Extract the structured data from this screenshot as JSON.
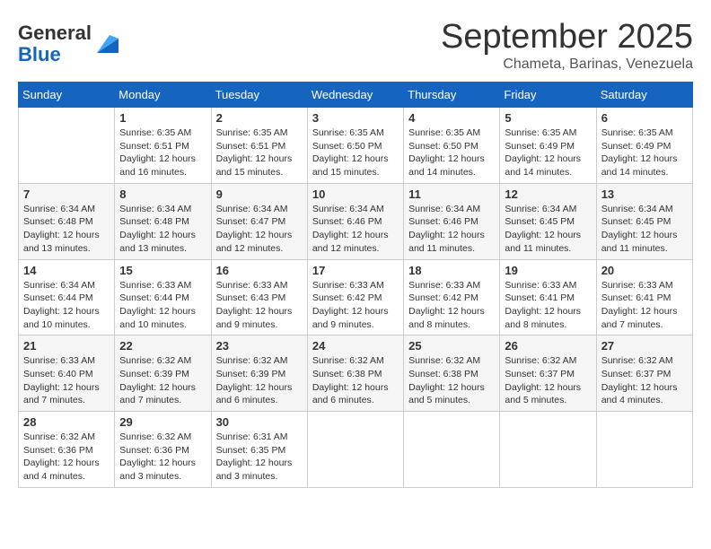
{
  "header": {
    "logo_line1": "General",
    "logo_line2": "Blue",
    "month": "September 2025",
    "location": "Chameta, Barinas, Venezuela"
  },
  "days_of_week": [
    "Sunday",
    "Monday",
    "Tuesday",
    "Wednesday",
    "Thursday",
    "Friday",
    "Saturday"
  ],
  "weeks": [
    [
      {
        "day": "",
        "info": ""
      },
      {
        "day": "1",
        "info": "Sunrise: 6:35 AM\nSunset: 6:51 PM\nDaylight: 12 hours\nand 16 minutes."
      },
      {
        "day": "2",
        "info": "Sunrise: 6:35 AM\nSunset: 6:51 PM\nDaylight: 12 hours\nand 15 minutes."
      },
      {
        "day": "3",
        "info": "Sunrise: 6:35 AM\nSunset: 6:50 PM\nDaylight: 12 hours\nand 15 minutes."
      },
      {
        "day": "4",
        "info": "Sunrise: 6:35 AM\nSunset: 6:50 PM\nDaylight: 12 hours\nand 14 minutes."
      },
      {
        "day": "5",
        "info": "Sunrise: 6:35 AM\nSunset: 6:49 PM\nDaylight: 12 hours\nand 14 minutes."
      },
      {
        "day": "6",
        "info": "Sunrise: 6:35 AM\nSunset: 6:49 PM\nDaylight: 12 hours\nand 14 minutes."
      }
    ],
    [
      {
        "day": "7",
        "info": "Sunrise: 6:34 AM\nSunset: 6:48 PM\nDaylight: 12 hours\nand 13 minutes."
      },
      {
        "day": "8",
        "info": "Sunrise: 6:34 AM\nSunset: 6:48 PM\nDaylight: 12 hours\nand 13 minutes."
      },
      {
        "day": "9",
        "info": "Sunrise: 6:34 AM\nSunset: 6:47 PM\nDaylight: 12 hours\nand 12 minutes."
      },
      {
        "day": "10",
        "info": "Sunrise: 6:34 AM\nSunset: 6:46 PM\nDaylight: 12 hours\nand 12 minutes."
      },
      {
        "day": "11",
        "info": "Sunrise: 6:34 AM\nSunset: 6:46 PM\nDaylight: 12 hours\nand 11 minutes."
      },
      {
        "day": "12",
        "info": "Sunrise: 6:34 AM\nSunset: 6:45 PM\nDaylight: 12 hours\nand 11 minutes."
      },
      {
        "day": "13",
        "info": "Sunrise: 6:34 AM\nSunset: 6:45 PM\nDaylight: 12 hours\nand 11 minutes."
      }
    ],
    [
      {
        "day": "14",
        "info": "Sunrise: 6:34 AM\nSunset: 6:44 PM\nDaylight: 12 hours\nand 10 minutes."
      },
      {
        "day": "15",
        "info": "Sunrise: 6:33 AM\nSunset: 6:44 PM\nDaylight: 12 hours\nand 10 minutes."
      },
      {
        "day": "16",
        "info": "Sunrise: 6:33 AM\nSunset: 6:43 PM\nDaylight: 12 hours\nand 9 minutes."
      },
      {
        "day": "17",
        "info": "Sunrise: 6:33 AM\nSunset: 6:42 PM\nDaylight: 12 hours\nand 9 minutes."
      },
      {
        "day": "18",
        "info": "Sunrise: 6:33 AM\nSunset: 6:42 PM\nDaylight: 12 hours\nand 8 minutes."
      },
      {
        "day": "19",
        "info": "Sunrise: 6:33 AM\nSunset: 6:41 PM\nDaylight: 12 hours\nand 8 minutes."
      },
      {
        "day": "20",
        "info": "Sunrise: 6:33 AM\nSunset: 6:41 PM\nDaylight: 12 hours\nand 7 minutes."
      }
    ],
    [
      {
        "day": "21",
        "info": "Sunrise: 6:33 AM\nSunset: 6:40 PM\nDaylight: 12 hours\nand 7 minutes."
      },
      {
        "day": "22",
        "info": "Sunrise: 6:32 AM\nSunset: 6:39 PM\nDaylight: 12 hours\nand 7 minutes."
      },
      {
        "day": "23",
        "info": "Sunrise: 6:32 AM\nSunset: 6:39 PM\nDaylight: 12 hours\nand 6 minutes."
      },
      {
        "day": "24",
        "info": "Sunrise: 6:32 AM\nSunset: 6:38 PM\nDaylight: 12 hours\nand 6 minutes."
      },
      {
        "day": "25",
        "info": "Sunrise: 6:32 AM\nSunset: 6:38 PM\nDaylight: 12 hours\nand 5 minutes."
      },
      {
        "day": "26",
        "info": "Sunrise: 6:32 AM\nSunset: 6:37 PM\nDaylight: 12 hours\nand 5 minutes."
      },
      {
        "day": "27",
        "info": "Sunrise: 6:32 AM\nSunset: 6:37 PM\nDaylight: 12 hours\nand 4 minutes."
      }
    ],
    [
      {
        "day": "28",
        "info": "Sunrise: 6:32 AM\nSunset: 6:36 PM\nDaylight: 12 hours\nand 4 minutes."
      },
      {
        "day": "29",
        "info": "Sunrise: 6:32 AM\nSunset: 6:36 PM\nDaylight: 12 hours\nand 3 minutes."
      },
      {
        "day": "30",
        "info": "Sunrise: 6:31 AM\nSunset: 6:35 PM\nDaylight: 12 hours\nand 3 minutes."
      },
      {
        "day": "",
        "info": ""
      },
      {
        "day": "",
        "info": ""
      },
      {
        "day": "",
        "info": ""
      },
      {
        "day": "",
        "info": ""
      }
    ]
  ]
}
